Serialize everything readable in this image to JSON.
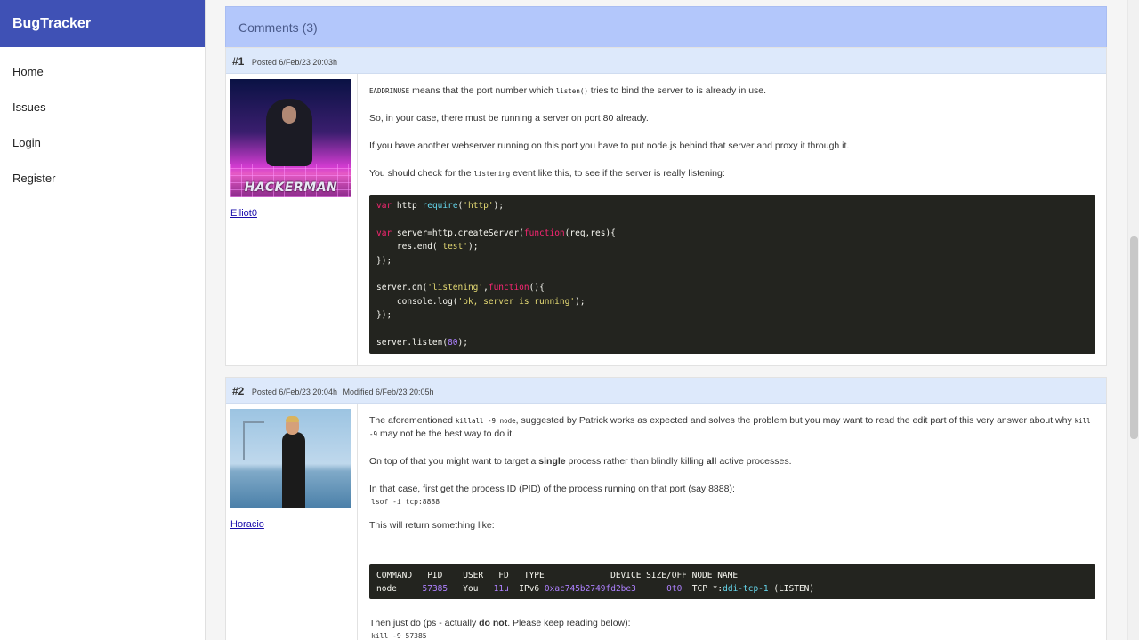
{
  "app": {
    "brand": "BugTracker"
  },
  "nav": [
    {
      "label": "Home"
    },
    {
      "label": "Issues"
    },
    {
      "label": "Login"
    },
    {
      "label": "Register"
    }
  ],
  "comments_panel": {
    "title": "Comments (3)"
  },
  "comment1": {
    "number": "#1",
    "posted": "Posted 6/Feb/23 20:03h",
    "author": "Elliot0",
    "avatar_text": "HACKERMAN",
    "p1_code": "EADDRINUSE",
    "p1_a": " means that the port number which ",
    "p1_code2": "listen()",
    "p1_b": " tries to bind the server to is already in use.",
    "p2": "So, in your case, there must be running a server on port 80 already.",
    "p3": "If you have another webserver running on this port you have to put node.js behind that server and proxy it through it.",
    "p4_a": "You should check for the ",
    "p4_code": "listening",
    "p4_b": " event like this, to see if the server is really listening:"
  },
  "comment2": {
    "number": "#2",
    "posted": "Posted 6/Feb/23 20:04h",
    "modified": "Modified 6/Feb/23 20:05h",
    "author": "Horacio",
    "p1_a": "The aforementioned ",
    "p1_code": "killall -9 node",
    "p1_b": ", suggested by Patrick works as expected and solves the problem but you may want to read the edit part of this very answer about why ",
    "p1_code2": "kill -9",
    "p1_c": " may not be the best way to do it.",
    "p2_a": "On top of that you might want to target a ",
    "p2_b1": "single",
    "p2_c": " process rather than blindly killing ",
    "p2_b2": "all",
    "p2_d": " active processes.",
    "p3": "In that case, first get the process ID (PID) of the process running on that port (say 8888):",
    "cmd1": "lsof -i tcp:8888",
    "p4": "This will return something like:",
    "out_header": "COMMAND   PID    USER   FD   TYPE             DEVICE SIZE/OFF NODE NAME",
    "out_cmd": "node",
    "out_pid": "57385",
    "out_user": "You",
    "out_fd": "11u",
    "out_type": "IPv6",
    "out_device": "0xac745b2749fd2be3",
    "out_size": "0t0",
    "out_node": "TCP",
    "out_name_a": "*:",
    "out_name_b": "ddi-tcp-1",
    "out_name_c": " (LISTEN)",
    "p5_a": "Then just do (ps - actually ",
    "p5_b": "do not",
    "p5_c": ". Please keep reading below):",
    "cmd2": "kill -9 57385"
  }
}
